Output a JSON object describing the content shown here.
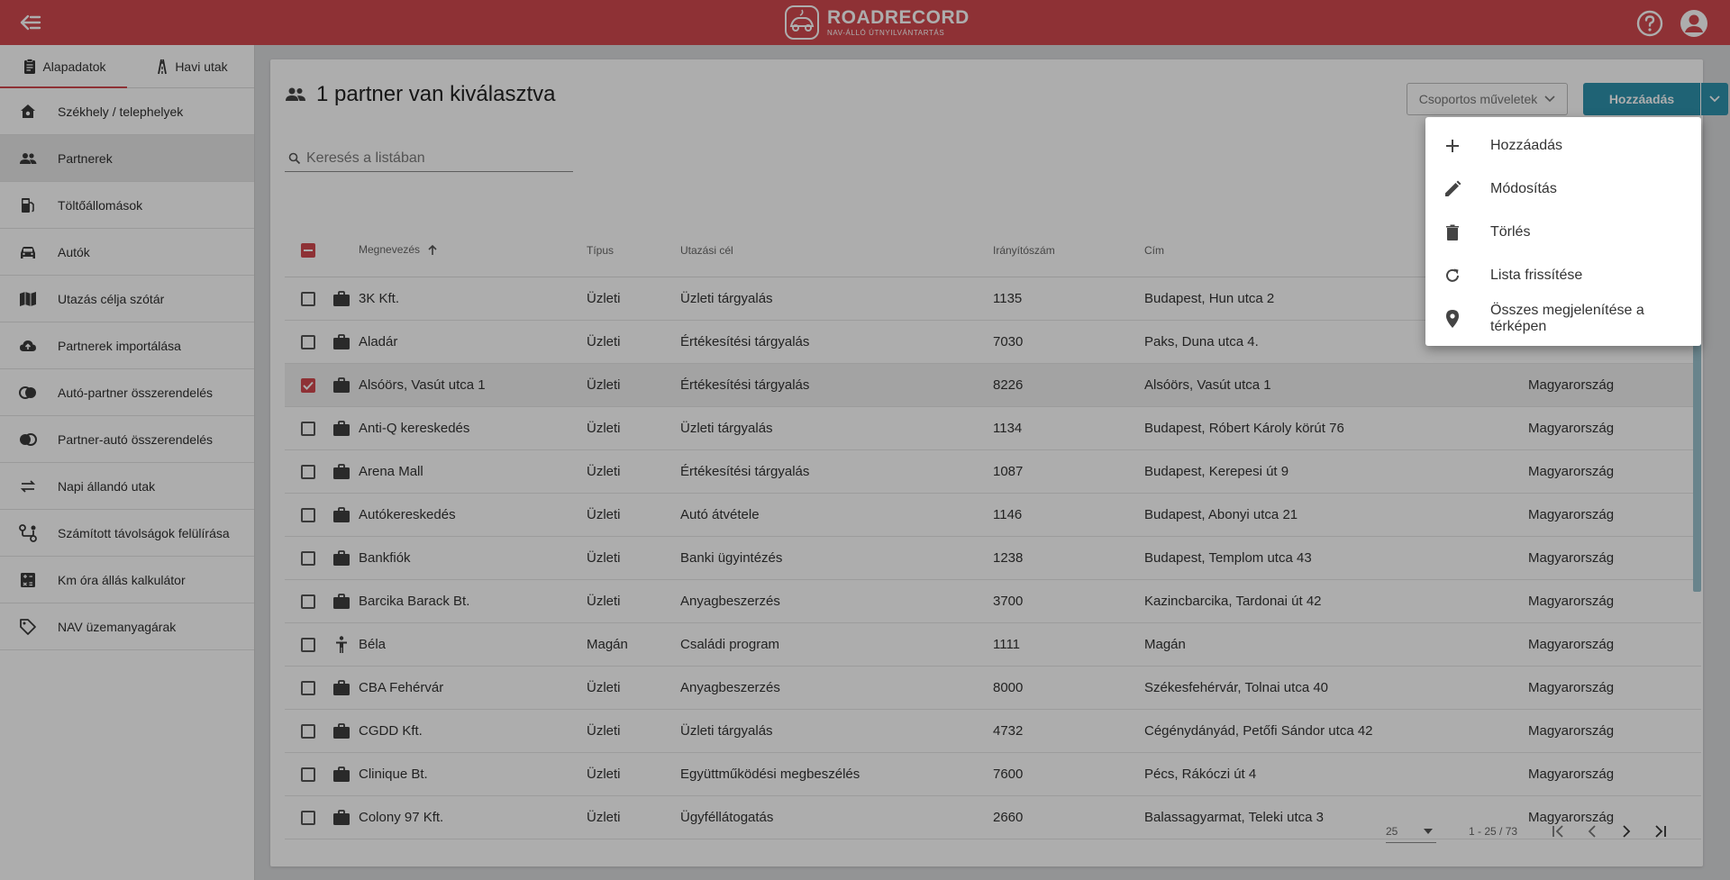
{
  "app": {
    "brand": "ROADRECORD",
    "tagline": "NAV-ÁLLÓ ÚTNYILVÁNTARTÁS",
    "accent": "#d2494e",
    "primary_button": "#2f93ad"
  },
  "tabs": [
    {
      "label": "Alapadatok",
      "icon": "clipboard-icon",
      "active": true
    },
    {
      "label": "Havi utak",
      "icon": "road-icon",
      "active": false
    }
  ],
  "sidebar": {
    "items": [
      {
        "label": "Székhely / telephelyek",
        "icon": "home-gear-icon"
      },
      {
        "label": "Partnerek",
        "icon": "people-icon",
        "selected": true
      },
      {
        "label": "Töltőállomások",
        "icon": "fuel-pump-icon"
      },
      {
        "label": "Autók",
        "icon": "car-icon"
      },
      {
        "label": "Utazás célja szótár",
        "icon": "map-book-icon"
      },
      {
        "label": "Partnerek importálása",
        "icon": "cloud-upload-icon"
      },
      {
        "label": "Autó-partner összerendelés",
        "icon": "link-circles-icon"
      },
      {
        "label": "Partner-autó összerendelés",
        "icon": "link-circles-icon"
      },
      {
        "label": "Napi állandó utak",
        "icon": "repeat-icon"
      },
      {
        "label": "Számított távolságok felülírása",
        "icon": "route-icon"
      },
      {
        "label": "Km óra állás kalkulátor",
        "icon": "calculator-icon"
      },
      {
        "label": "NAV üzemanyagárak",
        "icon": "price-tag-icon"
      }
    ]
  },
  "main": {
    "title": "1 partner van kiválasztva",
    "group_actions": "Csoportos műveletek",
    "add": "Hozzáadás",
    "search_placeholder": "Keresés a listában"
  },
  "table": {
    "headers": {
      "name": "Megnevezés",
      "type": "Típus",
      "purpose": "Utazási cél",
      "zip": "Irányítószám",
      "address": "Cím"
    },
    "rows": [
      {
        "name": "3K Kft.",
        "type": "Üzleti",
        "purpose": "Üzleti tárgyalás",
        "zip": "1135",
        "address": "Budapest, Hun utca 2",
        "country": "",
        "icon": "briefcase-icon",
        "checked": false
      },
      {
        "name": "Aladár",
        "type": "Üzleti",
        "purpose": "Értékesítési tárgyalás",
        "zip": "7030",
        "address": "Paks, Duna utca 4.",
        "country": "",
        "icon": "briefcase-icon",
        "checked": false
      },
      {
        "name": "Alsóörs, Vasút utca 1",
        "type": "Üzleti",
        "purpose": "Értékesítési tárgyalás",
        "zip": "8226",
        "address": "Alsóörs, Vasút utca 1",
        "country": "Magyarország",
        "icon": "briefcase-icon",
        "checked": true
      },
      {
        "name": "Anti-Q kereskedés",
        "type": "Üzleti",
        "purpose": "Üzleti tárgyalás",
        "zip": "1134",
        "address": "Budapest, Róbert Károly körút 76",
        "country": "Magyarország",
        "icon": "briefcase-icon",
        "checked": false
      },
      {
        "name": "Arena Mall",
        "type": "Üzleti",
        "purpose": "Értékesítési tárgyalás",
        "zip": "1087",
        "address": "Budapest, Kerepesi út 9",
        "country": "Magyarország",
        "icon": "briefcase-icon",
        "checked": false
      },
      {
        "name": "Autókereskedés",
        "type": "Üzleti",
        "purpose": "Autó átvétele",
        "zip": "1146",
        "address": "Budapest, Abonyi utca 21",
        "country": "Magyarország",
        "icon": "briefcase-icon",
        "checked": false
      },
      {
        "name": "Bankfiók",
        "type": "Üzleti",
        "purpose": "Banki ügyintézés",
        "zip": "1238",
        "address": "Budapest, Templom utca 43",
        "country": "Magyarország",
        "icon": "briefcase-icon",
        "checked": false
      },
      {
        "name": "Barcika Barack Bt.",
        "type": "Üzleti",
        "purpose": "Anyagbeszerzés",
        "zip": "3700",
        "address": "Kazincbarcika, Tardonai út 42",
        "country": "Magyarország",
        "icon": "briefcase-icon",
        "checked": false
      },
      {
        "name": "Béla",
        "type": "Magán",
        "purpose": "Családi program",
        "zip": "1111",
        "address": "Magán",
        "country": "Magyarország",
        "icon": "person-icon",
        "checked": false
      },
      {
        "name": "CBA Fehérvár",
        "type": "Üzleti",
        "purpose": "Anyagbeszerzés",
        "zip": "8000",
        "address": "Székesfehérvár, Tolnai utca 40",
        "country": "Magyarország",
        "icon": "briefcase-icon",
        "checked": false
      },
      {
        "name": "CGDD Kft.",
        "type": "Üzleti",
        "purpose": "Üzleti tárgyalás",
        "zip": "4732",
        "address": "Cégénydányád, Petőfi Sándor utca 42",
        "country": "Magyarország",
        "icon": "briefcase-icon",
        "checked": false
      },
      {
        "name": "Clinique Bt.",
        "type": "Üzleti",
        "purpose": "Együttműködési megbeszélés",
        "zip": "7600",
        "address": "Pécs, Rákóczi út 4",
        "country": "Magyarország",
        "icon": "briefcase-icon",
        "checked": false
      },
      {
        "name": "Colony 97 Kft.",
        "type": "Üzleti",
        "purpose": "Ügyféllátogatás",
        "zip": "2660",
        "address": "Balassagyarmat, Teleki utca 3",
        "country": "Magyarország",
        "icon": "briefcase-icon",
        "checked": false
      }
    ]
  },
  "paginator": {
    "page_size": "25",
    "range": "1 - 25 / 73"
  },
  "menu": {
    "items": [
      {
        "label": "Hozzáadás",
        "icon": "plus-icon"
      },
      {
        "label": "Módosítás",
        "icon": "pencil-icon",
        "highlighted": true
      },
      {
        "label": "Törlés",
        "icon": "trash-icon"
      },
      {
        "label": "Lista frissítése",
        "icon": "refresh-icon"
      },
      {
        "label": "Összes megjelenítése a térképen",
        "icon": "map-pin-icon"
      }
    ]
  }
}
